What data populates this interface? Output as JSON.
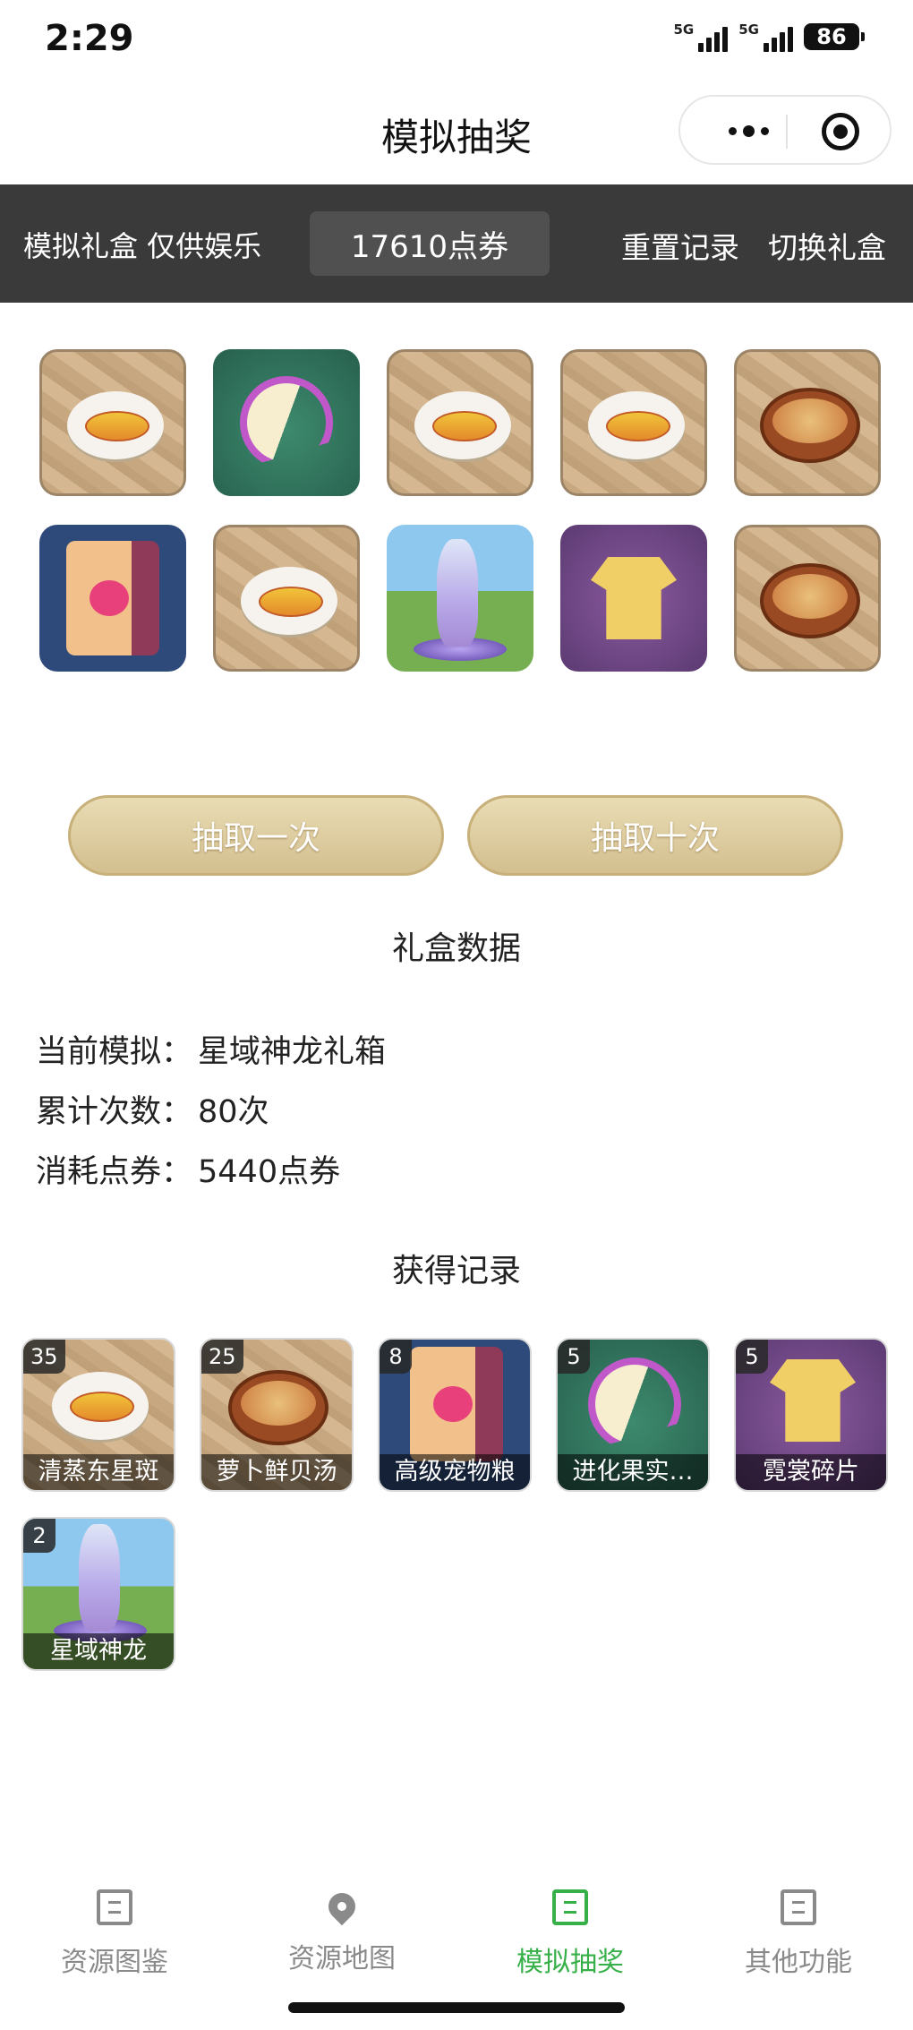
{
  "status_bar": {
    "time": "2:29",
    "network_1": "5G",
    "network_2": "5G",
    "battery": "86"
  },
  "nav": {
    "title": "模拟抽奖"
  },
  "toolbar": {
    "subtitle": "模拟礼盒 仅供娱乐",
    "points": "17610点券",
    "reset_label": "重置记录",
    "switch_label": "切换礼盒"
  },
  "pool_tiles": [
    {
      "kind": "fish-dish"
    },
    {
      "kind": "lemon"
    },
    {
      "kind": "fish-dish"
    },
    {
      "kind": "fish-dish"
    },
    {
      "kind": "soup-bowl"
    },
    {
      "kind": "pet-food-bag"
    },
    {
      "kind": "fish-dish"
    },
    {
      "kind": "dragon"
    },
    {
      "kind": "shirt"
    },
    {
      "kind": "soup-bowl"
    }
  ],
  "buttons": {
    "draw_once": "抽取一次",
    "draw_ten": "抽取十次"
  },
  "gift_data": {
    "title": "礼盒数据",
    "current_label": "当前模拟：",
    "current_value": "星域神龙礼箱",
    "count_label": "累计次数：",
    "count_value": "80次",
    "cost_label": "消耗点券：",
    "cost_value": "5440点券"
  },
  "records": {
    "title": "获得记录",
    "items": [
      {
        "count": "35",
        "name": "清蒸东星斑",
        "kind": "fish-dish"
      },
      {
        "count": "25",
        "name": "萝卜鲜贝汤",
        "kind": "soup-bowl"
      },
      {
        "count": "8",
        "name": "高级宠物粮",
        "kind": "pet-food-bag"
      },
      {
        "count": "5",
        "name": "进化果实…",
        "kind": "lemon"
      },
      {
        "count": "5",
        "name": "霓裳碎片",
        "kind": "shirt"
      },
      {
        "count": "2",
        "name": "星域神龙",
        "kind": "dragon"
      }
    ]
  },
  "tabs": [
    {
      "label": "资源图鉴",
      "icon": "doc-icon"
    },
    {
      "label": "资源地图",
      "icon": "map-pin-icon"
    },
    {
      "label": "模拟抽奖",
      "icon": "doc-icon",
      "active": true
    },
    {
      "label": "其他功能",
      "icon": "doc-icon"
    }
  ]
}
